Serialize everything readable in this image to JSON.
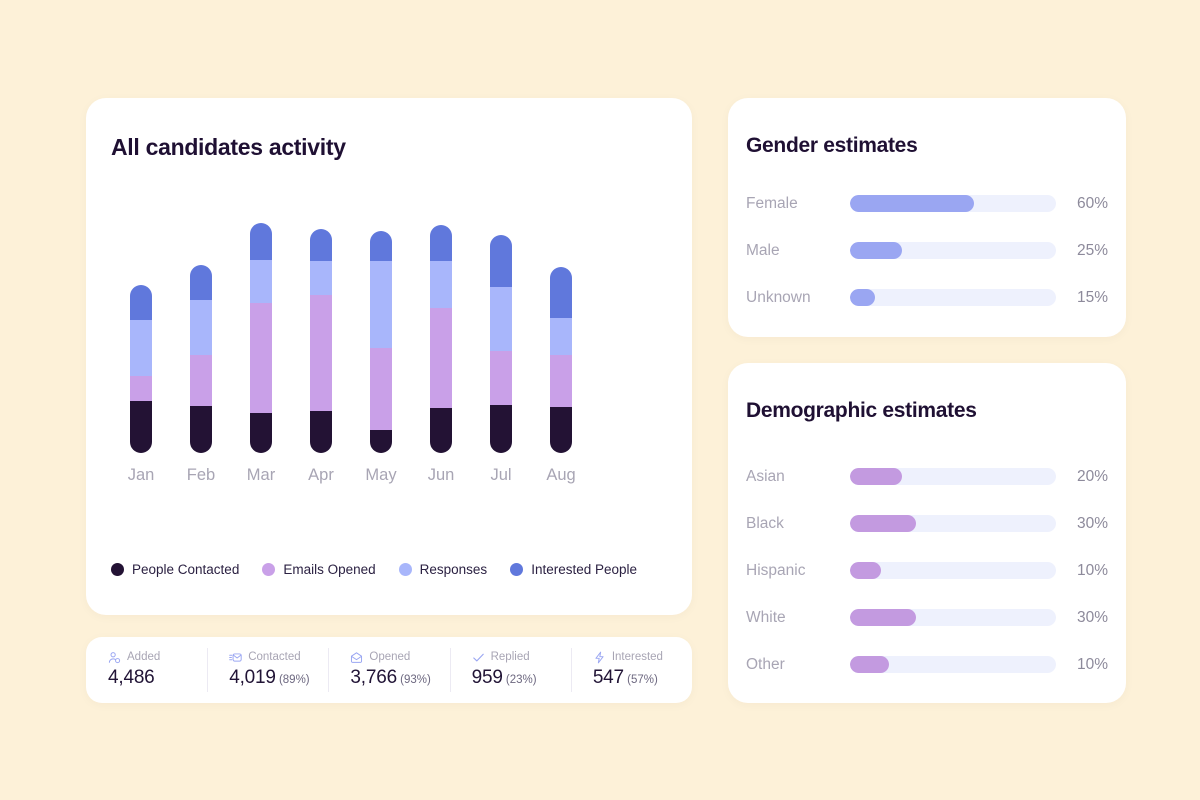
{
  "theme": {
    "page_background": "#fdf1d8",
    "card_background": "#ffffff",
    "title_color": "#1f1033",
    "muted_text": "#a8a5b4",
    "track_color": "#eef1fd",
    "gender_fill": "#9aa6f2",
    "demographic_fill": "#c39ae0"
  },
  "activity": {
    "title": "All candidates activity",
    "legend": [
      {
        "label": "People Contacted",
        "color": "#231234",
        "key": "people_contacted"
      },
      {
        "label": "Emails Opened",
        "color": "#c9a0e8",
        "key": "emails_opened"
      },
      {
        "label": "Responses",
        "color": "#a8b6fb",
        "key": "responses"
      },
      {
        "label": "Interested People",
        "color": "#6078dc",
        "key": "interested_people"
      }
    ]
  },
  "chart_data": {
    "type": "bar",
    "subtype": "stacked",
    "title": "All candidates activity",
    "xlabel": "",
    "ylabel": "",
    "grid": false,
    "legend_position": "bottom",
    "categories": [
      "Jan",
      "Feb",
      "Mar",
      "Apr",
      "May",
      "Jun",
      "Jul",
      "Aug"
    ],
    "unit": "px (stack segment heights)",
    "series": [
      {
        "name": "People Contacted",
        "color": "#231234",
        "values": [
          52,
          47,
          40,
          42,
          23,
          45,
          48,
          46
        ]
      },
      {
        "name": "Emails Opened",
        "color": "#c9a0e8",
        "values": [
          25,
          51,
          110,
          116,
          82,
          100,
          54,
          52
        ]
      },
      {
        "name": "Responses",
        "color": "#a8b6fb",
        "values": [
          56,
          55,
          43,
          34,
          87,
          47,
          64,
          37
        ]
      },
      {
        "name": "Interested People",
        "color": "#6078dc",
        "values": [
          35,
          35,
          37,
          32,
          30,
          36,
          52,
          51
        ]
      }
    ],
    "totals": [
      168,
      188,
      230,
      224,
      222,
      228,
      218,
      186
    ]
  },
  "stats": {
    "items": [
      {
        "icon": "person-add-icon",
        "label": "Added",
        "value": "4,486",
        "percent": ""
      },
      {
        "icon": "send-mail-icon",
        "label": "Contacted",
        "value": "4,019",
        "percent": "(89%)"
      },
      {
        "icon": "open-mail-icon",
        "label": "Opened",
        "value": "3,766",
        "percent": "(93%)"
      },
      {
        "icon": "check-icon",
        "label": "Replied",
        "value": "959",
        "percent": "(23%)"
      },
      {
        "icon": "bolt-icon",
        "label": "Interested",
        "value": "547",
        "percent": "(57%)"
      }
    ]
  },
  "gender": {
    "title": "Gender estimates",
    "rows": [
      {
        "label": "Female",
        "value": "60%",
        "fill_pct": 60
      },
      {
        "label": "Male",
        "value": "25%",
        "fill_pct": 25
      },
      {
        "label": "Unknown",
        "value": "15%",
        "fill_pct": 12
      }
    ]
  },
  "demographic": {
    "title": "Demographic estimates",
    "rows": [
      {
        "label": "Asian",
        "value": "20%",
        "fill_pct": 25
      },
      {
        "label": "Black",
        "value": "30%",
        "fill_pct": 32
      },
      {
        "label": "Hispanic",
        "value": "10%",
        "fill_pct": 15
      },
      {
        "label": "White",
        "value": "30%",
        "fill_pct": 32
      },
      {
        "label": "Other",
        "value": "10%",
        "fill_pct": 19
      }
    ]
  }
}
